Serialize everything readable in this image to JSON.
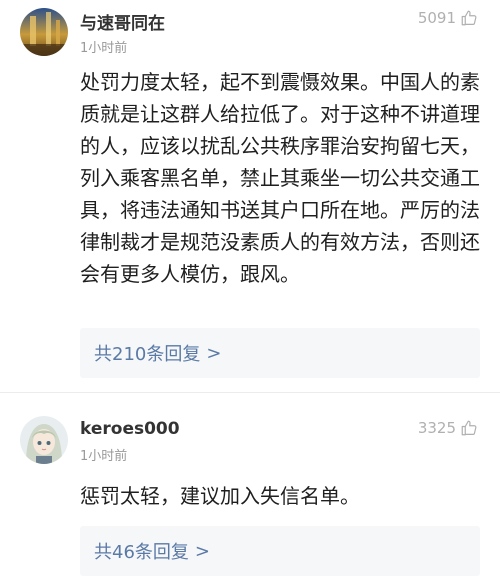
{
  "comments": [
    {
      "username": "与速哥同在",
      "time": "1小时前",
      "likes": "5091",
      "content": "处罚力度太轻，起不到震慑效果。中国人的素质就是让这群人给拉低了。对于这种不讲道理的人，应该以扰乱公共秩序罪治安拘留七天，列入乘客黑名单，禁止其乘坐一切公共交通工具，将违法通知书送其户口所在地。严厉的法律制裁才是规范没素质人的有效方法，否则还会有更多人模仿，跟风。",
      "replies": "共210条回复",
      "avatar_icon": "landscape-avatar"
    },
    {
      "username": "keroes000",
      "time": "1小时前",
      "likes": "3325",
      "content": "惩罚太轻，建议加入失信名单。",
      "replies": "共46条回复",
      "avatar_icon": "anime-girl-avatar"
    }
  ],
  "icons": {
    "like": "thumbs-up-icon",
    "reply_arrow": ">"
  },
  "colors": {
    "link": "#5a7aa6",
    "meta": "#9a9a9a",
    "reply_bg": "#f6f7f9"
  }
}
